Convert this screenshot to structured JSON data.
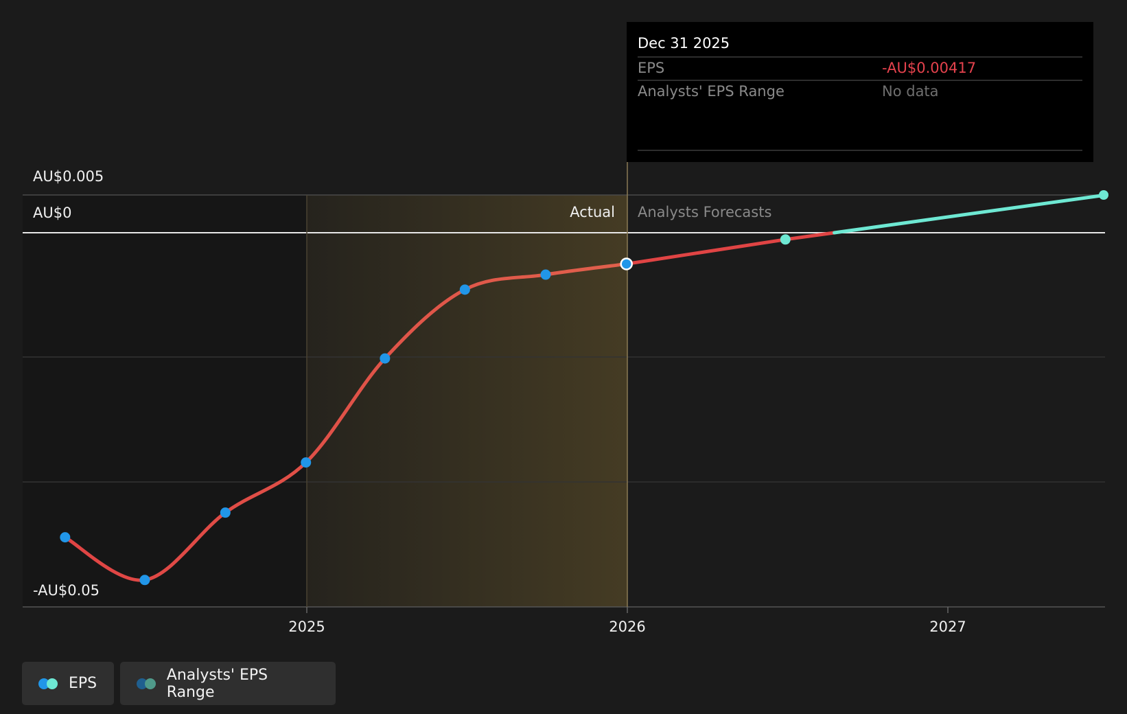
{
  "chart_data": {
    "type": "line",
    "y_ticks": [
      "AU$0.005",
      "AU$0",
      "-AU$0.05"
    ],
    "x_ticks": [
      "2025",
      "2026",
      "2027"
    ],
    "section_labels": {
      "actual": "Actual",
      "forecast": "Analysts Forecasts"
    },
    "series": [
      {
        "name": "EPS",
        "kind": "actual",
        "x": [
          "2024-03-31",
          "2024-06-30",
          "2024-09-30",
          "2024-12-31",
          "2025-03-31",
          "2025-06-30",
          "2025-09-30",
          "2025-12-31"
        ],
        "values": [
          -0.0407,
          -0.0464,
          -0.0374,
          -0.0307,
          -0.0168,
          -0.0076,
          -0.0056,
          -0.00417
        ]
      },
      {
        "name": "EPS",
        "kind": "forecast",
        "x": [
          "2025-12-31",
          "2026-06-30",
          "2027-06-30"
        ],
        "values": [
          -0.00417,
          -0.0009,
          0.005
        ]
      }
    ],
    "ylim": [
      -0.05,
      0.005
    ],
    "grid": true,
    "colors": {
      "line": "#e04444",
      "forecast_line": "#6ee8d3",
      "point_actual": "#2196e8",
      "point_forecast": "#6ee8d3",
      "actual_band": "#c9a23f"
    }
  },
  "tooltip": {
    "date": "Dec 31 2025",
    "rows": [
      {
        "label": "EPS",
        "value": "-AU$0.00417",
        "value_color": "#e5424d"
      },
      {
        "label": "Analysts' EPS Range",
        "value": "No data",
        "value_color": "#6f6f6f"
      }
    ]
  },
  "legend": {
    "items": [
      {
        "label": "EPS",
        "colors": [
          "#2196e8",
          "#6ee8d3"
        ]
      },
      {
        "label": "Analysts' EPS Range",
        "colors": [
          "#1f5f8f",
          "#4f9a8a"
        ]
      }
    ]
  }
}
